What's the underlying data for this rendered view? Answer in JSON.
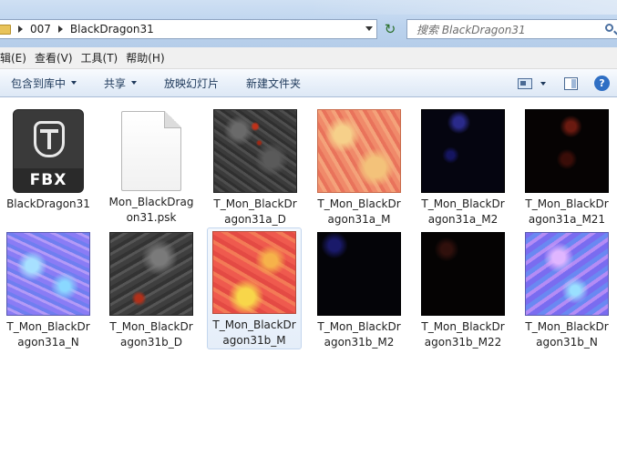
{
  "address": {
    "crumbs": [
      "007",
      "BlackDragon31"
    ]
  },
  "search": {
    "placeholder": "搜索 BlackDragon31"
  },
  "menu": [
    "辑(E)",
    "查看(V)",
    "工具(T)",
    "帮助(H)"
  ],
  "toolbar": {
    "include_library": "包含到库中",
    "share": "共享",
    "slideshow": "放映幻灯片",
    "new_folder": "新建文件夹"
  },
  "files": [
    {
      "name_lines": [
        "BlackDragon31"
      ],
      "kind": "fbx",
      "icon_text": "FBX"
    },
    {
      "name_lines": [
        "Mon_BlackDrag",
        "on31.psk"
      ],
      "kind": "doc"
    },
    {
      "name_lines": [
        "T_Mon_BlackDr",
        "agon31a_D"
      ],
      "kind": "tx-d"
    },
    {
      "name_lines": [
        "T_Mon_BlackDr",
        "agon31a_M"
      ],
      "kind": "tx-m"
    },
    {
      "name_lines": [
        "T_Mon_BlackDr",
        "agon31a_M2"
      ],
      "kind": "tx-m2"
    },
    {
      "name_lines": [
        "T_Mon_BlackDr",
        "agon31a_M21"
      ],
      "kind": "tx-m21"
    },
    {
      "name_lines": [
        "T_Mon_BlackDr",
        "agon31a_N"
      ],
      "kind": "tx-n"
    },
    {
      "name_lines": [
        "T_Mon_BlackDr",
        "agon31b_D"
      ],
      "kind": "tx-bd"
    },
    {
      "name_lines": [
        "T_Mon_BlackDr",
        "agon31b_M"
      ],
      "kind": "tx-bm",
      "selected": true
    },
    {
      "name_lines": [
        "T_Mon_BlackDr",
        "agon31b_M2"
      ],
      "kind": "tx-bm2"
    },
    {
      "name_lines": [
        "T_Mon_BlackDr",
        "agon31b_M22"
      ],
      "kind": "tx-bm22"
    },
    {
      "name_lines": [
        "T_Mon_BlackDr",
        "agon31b_N"
      ],
      "kind": "tx-bn"
    }
  ]
}
